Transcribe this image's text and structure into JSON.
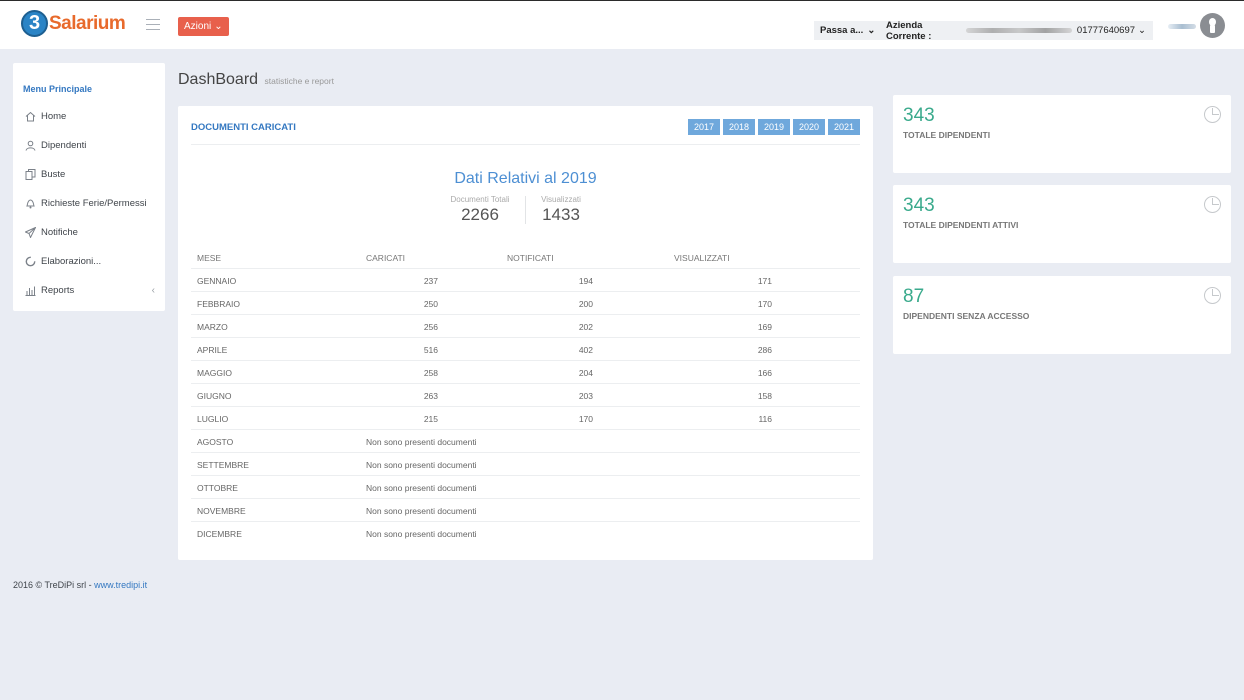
{
  "header": {
    "logo_digit": "3",
    "logo_text": "Salarium",
    "azioni_label": "Azioni",
    "passa_label": "Passa a...",
    "azienda_label": "Azienda Corrente :",
    "azienda_code": "01777640697"
  },
  "sidebar": {
    "title": "Menu Principale",
    "items": [
      {
        "label": "Home",
        "icon": "home-icon"
      },
      {
        "label": "Dipendenti",
        "icon": "user-icon"
      },
      {
        "label": "Buste",
        "icon": "copy-icon"
      },
      {
        "label": "Richieste Ferie/Permessi",
        "icon": "bell-icon"
      },
      {
        "label": "Notifiche",
        "icon": "paper-plane-icon"
      },
      {
        "label": "Elaborazioni...",
        "icon": "spinner-icon"
      },
      {
        "label": "Reports",
        "icon": "bar-chart-icon"
      }
    ]
  },
  "page": {
    "title": "DashBoard",
    "subtitle": "statistiche e report"
  },
  "panel": {
    "title": "DOCUMENTI CARICATI",
    "years": [
      "2017",
      "2018",
      "2019",
      "2020",
      "2021"
    ],
    "dati_title": "Dati Relativi al 2019",
    "docs_label": "Documenti Totali",
    "docs_value": "2266",
    "vis_label": "Visualizzati",
    "vis_value": "1433",
    "columns": [
      "MESE",
      "CARICATI",
      "NOTIFICATI",
      "VISUALIZZATI"
    ],
    "rows": [
      {
        "mese": "GENNAIO",
        "caricati": "237",
        "notificati": "194",
        "visualizzati": "171"
      },
      {
        "mese": "FEBBRAIO",
        "caricati": "250",
        "notificati": "200",
        "visualizzati": "170"
      },
      {
        "mese": "MARZO",
        "caricati": "256",
        "notificati": "202",
        "visualizzati": "169"
      },
      {
        "mese": "APRILE",
        "caricati": "516",
        "notificati": "402",
        "visualizzati": "286"
      },
      {
        "mese": "MAGGIO",
        "caricati": "258",
        "notificati": "204",
        "visualizzati": "166"
      },
      {
        "mese": "GIUGNO",
        "caricati": "263",
        "notificati": "203",
        "visualizzati": "158"
      },
      {
        "mese": "LUGLIO",
        "caricati": "215",
        "notificati": "170",
        "visualizzati": "116"
      }
    ],
    "empty_rows": [
      "AGOSTO",
      "SETTEMBRE",
      "OTTOBRE",
      "NOVEMBRE",
      "DICEMBRE"
    ],
    "empty_text": "Non sono presenti documenti"
  },
  "cards": [
    {
      "value": "343",
      "label": "TOTALE DIPENDENTI"
    },
    {
      "value": "343",
      "label": "TOTALE DIPENDENTI ATTIVI"
    },
    {
      "value": "87",
      "label": "DIPENDENTI SENZA ACCESSO"
    }
  ],
  "footer": {
    "text": "2016 © TreDiPi srl - ",
    "link": "www.tredipi.it"
  },
  "colors": {
    "accent_blue": "#3478c1",
    "azioni_red": "#e8604c",
    "year_button": "#6fa8dc",
    "card_value_green": "#3aaa8c"
  }
}
